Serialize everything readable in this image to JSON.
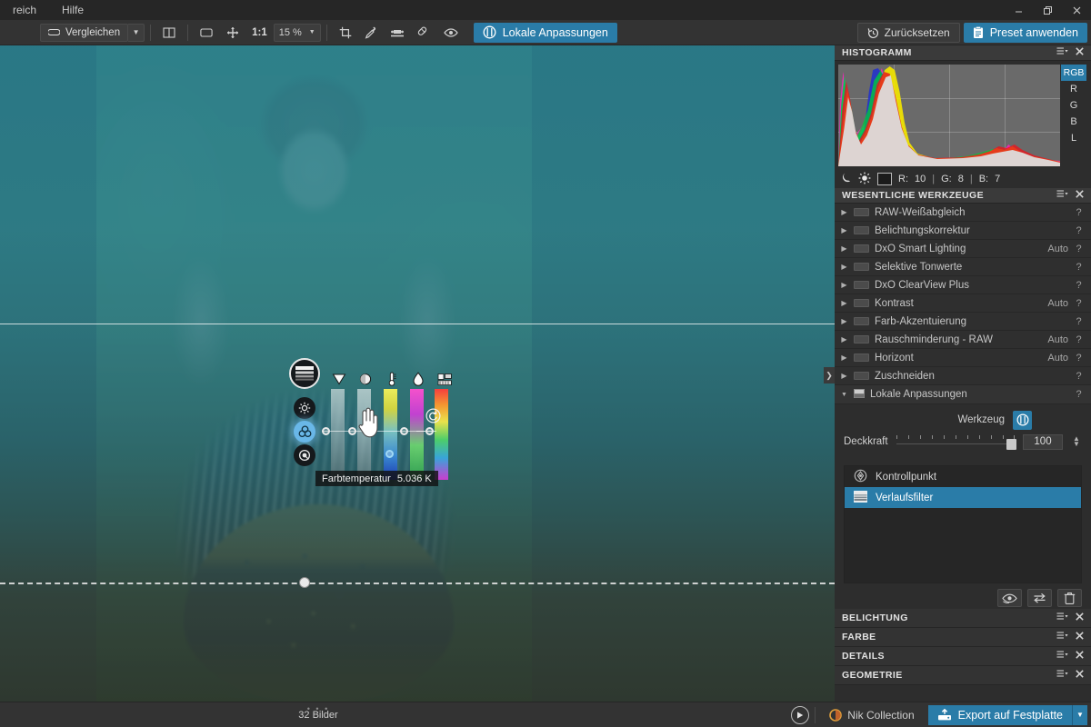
{
  "app": {
    "menu": [
      "reich",
      "Hilfe"
    ],
    "window_controls": {
      "minimize": "minimize-icon",
      "restore": "restore-icon",
      "close": "close-icon"
    }
  },
  "toolbar": {
    "compare_label": "Vergleichen",
    "compare_caret": "▼",
    "split_view_icon": "split-view-icon",
    "fit_icon": "fit-to-screen-icon",
    "pan_icon": "pan-hand-icon",
    "ratio_label": "1:1",
    "zoom_value": "15 %",
    "zoom_caret": "▼",
    "crop_icon": "crop-icon",
    "eyedropper_icon": "eyedropper-icon",
    "horizon_icon": "horizon-level-icon",
    "repair_icon": "repair-brush-icon",
    "preview_icon": "eye-preview-icon",
    "local_adjust_label": "Lokale Anpassungen",
    "reset_label": "Zurücksetzen",
    "preset_label": "Preset anwenden"
  },
  "histogram": {
    "title": "HISTOGRAMM",
    "channels": [
      "RGB",
      "R",
      "G",
      "B",
      "L"
    ],
    "selected_channel": "RGB",
    "shadow_icon": "moon-icon",
    "highlight_icon": "sun-icon",
    "readout": {
      "r_label": "R:",
      "r": "10",
      "sep1": "|",
      "g_label": "G:",
      "g": "8",
      "sep2": "|",
      "b_label": "B:",
      "b": "7"
    },
    "menu_icon": "panel-menu-icon",
    "close_icon": "panel-close-icon"
  },
  "essential_tools": {
    "title": "WESENTLICHE WERKZEUGE",
    "menu_icon": "panel-menu-icon",
    "close_icon": "panel-close-icon",
    "rows": [
      {
        "label": "RAW-Weißabgleich",
        "auto": "",
        "help": "?"
      },
      {
        "label": "Belichtungskorrektur",
        "auto": "",
        "help": "?"
      },
      {
        "label": "DxO Smart Lighting",
        "auto": "Auto",
        "help": "?"
      },
      {
        "label": "Selektive Tonwerte",
        "auto": "",
        "help": "?"
      },
      {
        "label": "DxO ClearView Plus",
        "auto": "",
        "help": "?"
      },
      {
        "label": "Kontrast",
        "auto": "Auto",
        "help": "?"
      },
      {
        "label": "Farb-Akzentuierung",
        "auto": "",
        "help": "?"
      },
      {
        "label": "Rauschminderung - RAW",
        "auto": "Auto",
        "help": "?"
      },
      {
        "label": "Horizont",
        "auto": "Auto",
        "help": "?"
      },
      {
        "label": "Zuschneiden",
        "auto": "",
        "help": "?"
      }
    ]
  },
  "local_adjustments_panel": {
    "title": "Lokale Anpassungen",
    "expanded_caret": "▼",
    "help": "?",
    "tool_label": "Werkzeug",
    "tool_icon": "local-adjustment-icon",
    "opacity_label": "Deckkraft",
    "opacity_value": "100",
    "masks": [
      {
        "label": "Kontrollpunkt",
        "icon": "control-point-icon",
        "selected": false
      },
      {
        "label": "Verlaufsfilter",
        "icon": "graduated-filter-icon",
        "selected": true
      }
    ],
    "mask_tools": [
      {
        "name": "toggle-mask-visibility-button",
        "icon": "eye-mask-icon"
      },
      {
        "name": "invert-mask-button",
        "icon": "swap-arrows-icon"
      },
      {
        "name": "delete-mask-button",
        "icon": "trash-icon"
      }
    ]
  },
  "sections": [
    {
      "title": "BELICHTUNG",
      "menu_icon": "panel-menu-icon",
      "close_icon": "panel-close-icon"
    },
    {
      "title": "FARBE",
      "menu_icon": "panel-menu-icon",
      "close_icon": "panel-close-icon"
    },
    {
      "title": "DETAILS",
      "menu_icon": "panel-menu-icon",
      "close_icon": "panel-close-icon"
    },
    {
      "title": "GEOMETRIE",
      "menu_icon": "panel-menu-icon",
      "close_icon": "panel-close-icon"
    }
  ],
  "canvas_widget": {
    "main_icon": "graduated-filter-handle-icon",
    "side_buttons": [
      {
        "name": "brightness-mode-button",
        "icon": "sun-small-icon",
        "active": false
      },
      {
        "name": "color-mode-button",
        "icon": "color-circles-icon",
        "active": true
      },
      {
        "name": "detail-mode-button",
        "icon": "detail-circle-icon",
        "active": false
      }
    ],
    "slider_icons": [
      "exposure-triangle-icon",
      "contrast-sphere-icon",
      "temperature-thermometer-icon",
      "saturation-drop-icon",
      "structure-blocks-icon"
    ],
    "tooltip_label": "Farbtemperatur",
    "tooltip_value": "5.036 K",
    "reset_icon": "reset-arrow-icon",
    "cursor": "hand-cursor-icon"
  },
  "statusbar": {
    "image_count": "32 Bilder",
    "dots": "• • •",
    "send_icon": "send-to-icon",
    "nik_label": "Nik Collection",
    "nik_icon": "nik-collection-icon",
    "export_label": "Export auf Festplatte",
    "export_icon": "export-disk-icon",
    "export_caret": "▼"
  },
  "colors": {
    "accent": "#2a7ca8",
    "panel_bg": "#2d2d2d",
    "toolbar_bg": "#333333",
    "canvas_bg": "#2b2b2b",
    "text": "#d2d2d2",
    "overlay_teal": "#2a8292"
  }
}
